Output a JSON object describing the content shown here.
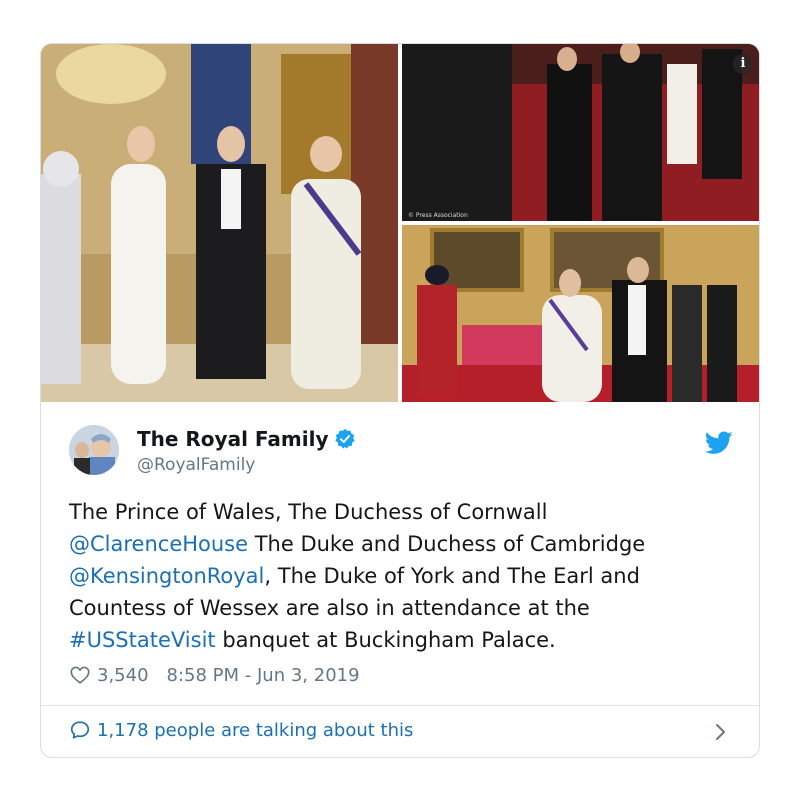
{
  "media": {
    "photo_1_alt": "",
    "photo_2_credit": "© Press Association",
    "info_icon_label": "i"
  },
  "author": {
    "name": "The Royal Family",
    "handle": "@RoyalFamily"
  },
  "tweet": {
    "part1": "The Prince of Wales, The Duchess of Cornwall ",
    "mention1": "@ClarenceHouse",
    "part2": " The Duke and Duchess of Cambridge ",
    "mention2": "@KensingtonRoyal",
    "part3": ", The Duke of York and The Earl and Countess of Wessex are also in attendance at the ",
    "hashtag": "#USStateVisit",
    "part4": " banquet at Buckingham Palace."
  },
  "meta": {
    "likes": "3,540",
    "timestamp": "8:58 PM - Jun 3, 2019"
  },
  "footer": {
    "talking": "1,178 people are talking about this"
  },
  "colors": {
    "link": "#1b6fb5",
    "twitter_blue": "#1da1f2",
    "text": "#14171a",
    "muted": "#657786"
  }
}
